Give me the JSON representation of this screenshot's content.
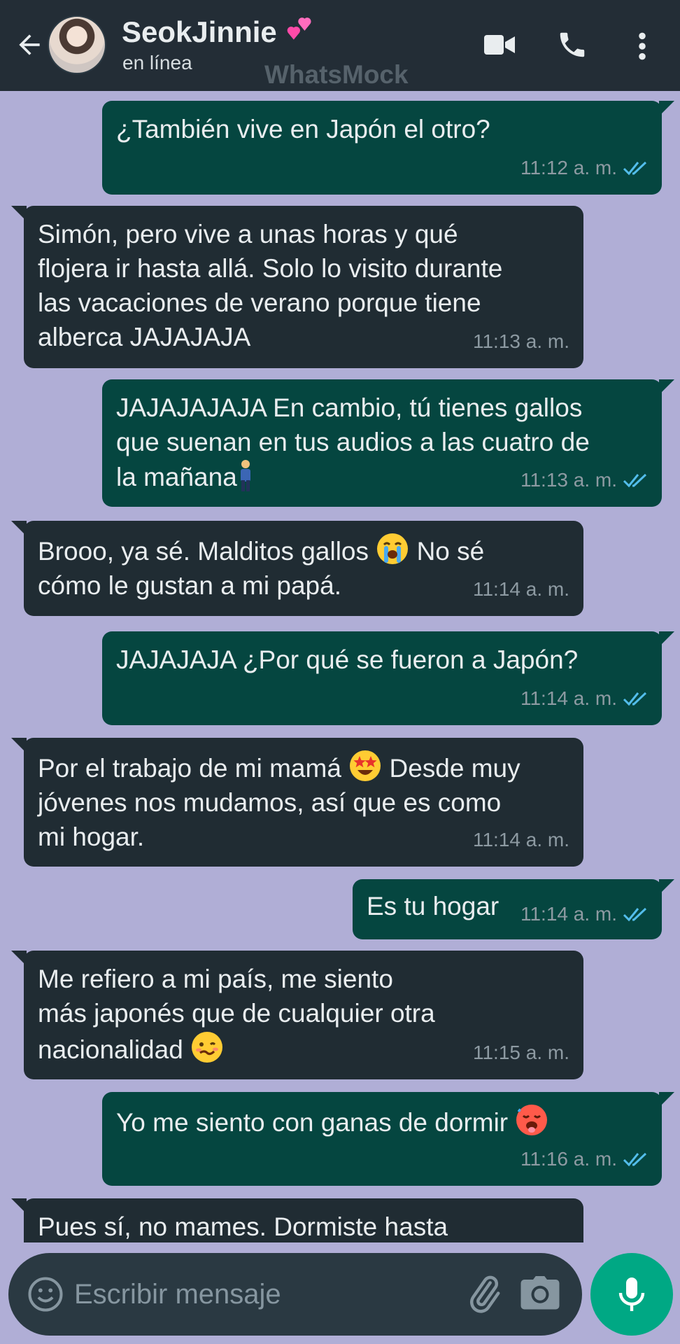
{
  "header": {
    "contact_name": "SeokJinnie",
    "status": "en línea",
    "watermark": "WhatsMock",
    "icons": [
      "back-arrow-icon",
      "video-call-icon",
      "phone-icon",
      "more-vert-icon",
      "two-hearts-icon"
    ]
  },
  "messages": [
    {
      "direction": "out",
      "text": "¿También vive en Japón el otro?",
      "time": "11:12 a. m.",
      "read": true
    },
    {
      "direction": "in",
      "text": "Simón, pero vive a unas horas y qué\nflojera ir hasta allá. Solo lo visito durante\nlas vacaciones de verano porque tiene\nalberca JAJAJAJA",
      "time": "11:13 a. m."
    },
    {
      "direction": "out",
      "text": "JAJAJAJAJA En cambio, tú tienes gallos\nque suenan en tus audios a las cuatro de\nla mañana",
      "emoji": "person-standing",
      "time": "11:13 a. m.",
      "read": true
    },
    {
      "direction": "in",
      "text_a": "Brooo, ya sé. Malditos gallos ",
      "emoji": "loudly-crying-face",
      "text_b": " No sé\ncómo le gustan a mi papá.",
      "time": "11:14 a. m."
    },
    {
      "direction": "out",
      "text": "JAJAJAJA ¿Por qué se fueron a Japón?",
      "time": "11:14 a. m.",
      "read": true
    },
    {
      "direction": "in",
      "text_a": "Por el trabajo de mi mamá ",
      "emoji": "star-struck",
      "text_b": " Desde muy\njóvenes nos mudamos, así que es como\nmi hogar.",
      "time": "11:14 a. m."
    },
    {
      "direction": "out",
      "text": "Es tu hogar",
      "time": "11:14 a. m.",
      "read": true
    },
    {
      "direction": "in",
      "text": "Me refiero a mi país, me siento\nmás japonés que de cualquier otra\nnacionalidad",
      "emoji": "woozy-face",
      "time": "11:15 a. m."
    },
    {
      "direction": "out",
      "text": "Yo me siento con ganas de dormir",
      "emoji": "hot-face",
      "time": "11:16 a. m.",
      "read": true
    },
    {
      "direction": "in",
      "text": "Pues sí, no mames. Dormiste hasta"
    }
  ],
  "composer": {
    "placeholder": "Escribir mensaje",
    "icons": [
      "emoji-icon",
      "attach-icon",
      "camera-icon",
      "mic-icon"
    ]
  },
  "colors": {
    "chat_background": "#b0aed6",
    "header": "#232d36",
    "outgoing_bubble": "#054640",
    "incoming_bubble": "#202c33",
    "read_ticks": "#53bdeb",
    "mic_button": "#00a884"
  }
}
